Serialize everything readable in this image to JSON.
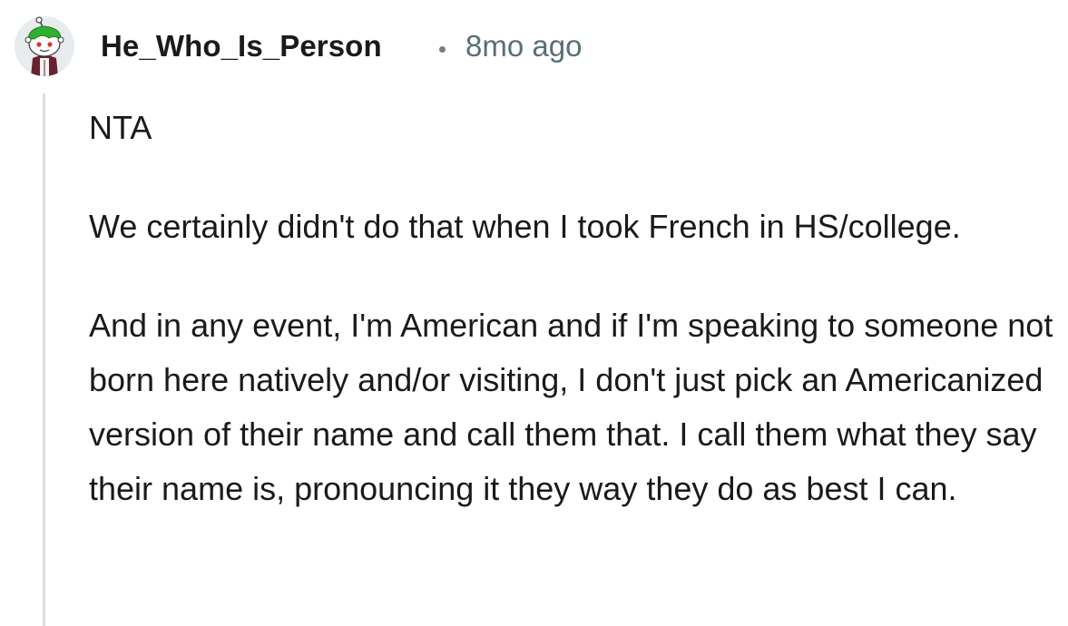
{
  "comment": {
    "author": "He_Who_Is_Person",
    "separator": "•",
    "time": "8mo ago",
    "paragraphs": [
      "NTA",
      "We certainly didn't do that when I took French in HS/college.",
      "And in any event, I'm American and if I'm speaking to someone not born here natively and/or visiting, I don't just pick an Americanized version of their name and call them that. I call them what they say their name is, pronouncing it they way they do as best I can."
    ]
  },
  "icons": {
    "avatar": "reddit-snoo-avatar-icon",
    "thread": "thread-collapse-line"
  },
  "colors": {
    "text": "#1a1a1b",
    "meta": "#576f76",
    "thread_line": "#dadde0",
    "avatar_bg": "#e9ecef",
    "avatar_hair": "#2fb02f"
  }
}
